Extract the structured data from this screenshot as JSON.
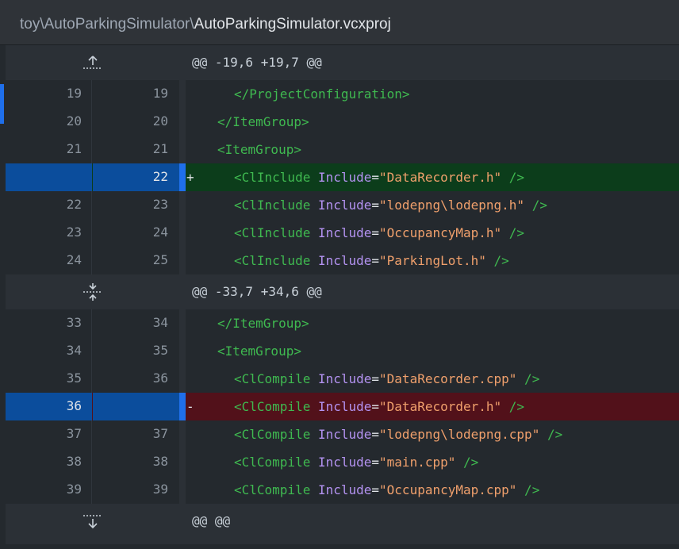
{
  "header": {
    "dir": "toy\\AutoParkingSimulator\\",
    "file": "AutoParkingSimulator.vcxproj"
  },
  "hunks": [
    {
      "text": "@@ -19,6 +19,7 @@",
      "expand_icon": "expand-up-icon"
    },
    {
      "text": "@@ -33,7 +34,6 @@",
      "expand_icon": "expand-both-icon"
    },
    {
      "text": "@@ @@",
      "expand_icon": "expand-down-icon"
    }
  ],
  "lines": [
    {
      "old": "19",
      "new": "19",
      "marker": "",
      "tag": "</ProjectConfiguration>",
      "attr": "",
      "eq": "",
      "val": "",
      "close": ""
    },
    {
      "old": "20",
      "new": "20",
      "marker": "",
      "tag": "</ItemGroup>",
      "attr": "",
      "eq": "",
      "val": "",
      "close": ""
    },
    {
      "old": "21",
      "new": "21",
      "marker": "",
      "tag": "<ItemGroup>",
      "attr": "",
      "eq": "",
      "val": "",
      "close": ""
    },
    {
      "old": "",
      "new": "22",
      "marker": "+",
      "tag": "<ClInclude",
      "attr": " Include",
      "eq": "=",
      "val": "\"DataRecorder.h\"",
      "close": " />"
    },
    {
      "old": "22",
      "new": "23",
      "marker": "",
      "tag": "<ClInclude",
      "attr": " Include",
      "eq": "=",
      "val": "\"lodepng\\lodepng.h\"",
      "close": " />"
    },
    {
      "old": "23",
      "new": "24",
      "marker": "",
      "tag": "<ClInclude",
      "attr": " Include",
      "eq": "=",
      "val": "\"OccupancyMap.h\"",
      "close": " />"
    },
    {
      "old": "24",
      "new": "25",
      "marker": "",
      "tag": "<ClInclude",
      "attr": " Include",
      "eq": "=",
      "val": "\"ParkingLot.h\"",
      "close": " />"
    },
    {
      "old": "33",
      "new": "34",
      "marker": "",
      "tag": "</ItemGroup>",
      "attr": "",
      "eq": "",
      "val": "",
      "close": ""
    },
    {
      "old": "34",
      "new": "35",
      "marker": "",
      "tag": "<ItemGroup>",
      "attr": "",
      "eq": "",
      "val": "",
      "close": ""
    },
    {
      "old": "35",
      "new": "36",
      "marker": "",
      "tag": "<ClCompile",
      "attr": " Include",
      "eq": "=",
      "val": "\"DataRecorder.cpp\"",
      "close": " />"
    },
    {
      "old": "36",
      "new": "",
      "marker": "-",
      "tag": "<ClCompile",
      "attr": " Include",
      "eq": "=",
      "val": "\"DataRecorder.h\"",
      "close": " />"
    },
    {
      "old": "37",
      "new": "37",
      "marker": "",
      "tag": "<ClCompile",
      "attr": " Include",
      "eq": "=",
      "val": "\"lodepng\\lodepng.cpp\"",
      "close": " />"
    },
    {
      "old": "38",
      "new": "38",
      "marker": "",
      "tag": "<ClCompile",
      "attr": " Include",
      "eq": "=",
      "val": "\"main.cpp\"",
      "close": " />"
    },
    {
      "old": "39",
      "new": "39",
      "marker": "",
      "tag": "<ClCompile",
      "attr": " Include",
      "eq": "=",
      "val": "\"OccupancyMap.cpp\"",
      "close": " />"
    }
  ]
}
